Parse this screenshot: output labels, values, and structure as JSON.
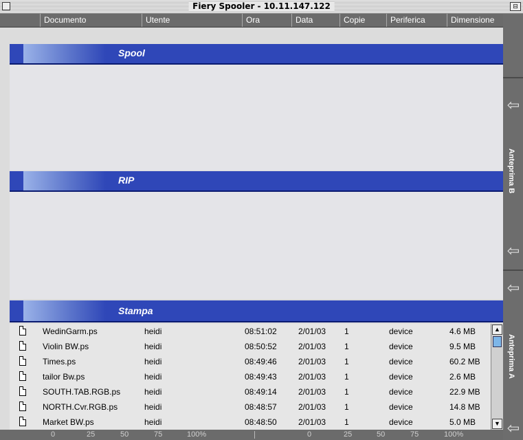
{
  "window": {
    "title": "Fiery Spooler - 10.11.147.122"
  },
  "columns": [
    "Documento",
    "Utente",
    "Ora",
    "Data",
    "Copie",
    "Periferica",
    "Dimensione"
  ],
  "sections": {
    "spool": "Spool",
    "rip": "RIP",
    "print": "Stampa"
  },
  "side_panel": {
    "preview_b": "Anteprima B",
    "preview_a": "Anteprima A"
  },
  "print_jobs": [
    {
      "name": "WedinGarm.ps",
      "user": "heidi",
      "time": "08:51:02",
      "date": "2/01/03",
      "copies": "1",
      "device": "device",
      "size": "4.6 MB"
    },
    {
      "name": "Violin BW.ps",
      "user": "heidi",
      "time": "08:50:52",
      "date": "2/01/03",
      "copies": "1",
      "device": "device",
      "size": "9.5 MB"
    },
    {
      "name": "Times.ps",
      "user": "heidi",
      "time": "08:49:46",
      "date": "2/01/03",
      "copies": "1",
      "device": "device",
      "size": "60.2 MB"
    },
    {
      "name": "tailor Bw.ps",
      "user": "heidi",
      "time": "08:49:43",
      "date": "2/01/03",
      "copies": "1",
      "device": "device",
      "size": "2.6 MB"
    },
    {
      "name": "SOUTH.TAB.RGB.ps",
      "user": "heidi",
      "time": "08:49:14",
      "date": "2/01/03",
      "copies": "1",
      "device": "device",
      "size": "22.9 MB"
    },
    {
      "name": "NORTH.Cvr.RGB.ps",
      "user": "heidi",
      "time": "08:48:57",
      "date": "2/01/03",
      "copies": "1",
      "device": "device",
      "size": "14.8 MB"
    },
    {
      "name": "Market BW.ps",
      "user": "heidi",
      "time": "08:48:50",
      "date": "2/01/03",
      "copies": "1",
      "device": "device",
      "size": "5.0 MB"
    }
  ],
  "progress_scale_left": [
    "0",
    "25",
    "50",
    "75",
    "100%"
  ],
  "progress_scale_right": [
    "0",
    "25",
    "50",
    "75",
    "100%"
  ],
  "colors": {
    "section_blue": "#2f47b8",
    "header_gray": "#6b6b6b",
    "scroll_thumb": "#7db6e8"
  }
}
